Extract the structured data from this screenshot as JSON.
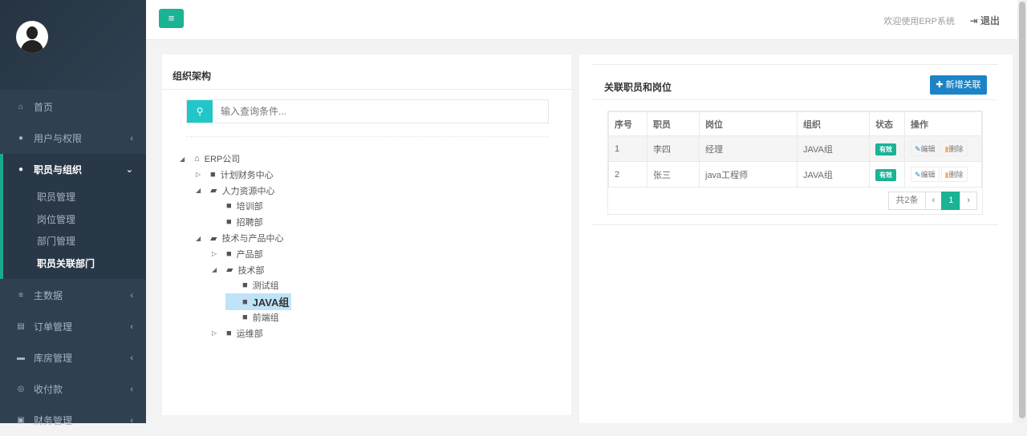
{
  "sidebar": {
    "items": [
      {
        "label": "首页",
        "icon": "home-icon"
      },
      {
        "label": "用户与权限",
        "icon": "info-icon"
      },
      {
        "label": "职员与组织",
        "icon": "user-circle-icon"
      },
      {
        "label": "主数据",
        "icon": "database-icon"
      },
      {
        "label": "订单管理",
        "icon": "list-alt-icon"
      },
      {
        "label": "库房管理",
        "icon": "truck-icon"
      },
      {
        "label": "收付款",
        "icon": "handshake-icon"
      },
      {
        "label": "财务管理",
        "icon": "calculator-icon"
      }
    ],
    "sub_items": [
      "职员管理",
      "岗位管理",
      "部门管理",
      "职员关联部门"
    ]
  },
  "header": {
    "welcome": "欢迎使用ERP系统",
    "logout": "退出"
  },
  "org": {
    "title": "组织架构",
    "search_placeholder": "输入查询条件...",
    "tree": [
      "ERP公司",
      "计划财务中心",
      "人力资源中心",
      "培训部",
      "招聘部",
      "技术与产品中心",
      "产品部",
      "技术部",
      "测试组",
      "JAVA组",
      "前端组",
      "运维部"
    ]
  },
  "assoc": {
    "title": "关联职员和岗位",
    "add_label": "新增关联",
    "columns": [
      "序号",
      "职员",
      "岗位",
      "组织",
      "状态",
      "操作"
    ],
    "rows": [
      {
        "no": "1",
        "staff": "李四",
        "post": "经理",
        "org": "JAVA组",
        "status": "有效"
      },
      {
        "no": "2",
        "staff": "张三",
        "post": "java工程师",
        "org": "JAVA组",
        "status": "有效"
      }
    ],
    "edit": "编辑",
    "delete": "删除",
    "total": "共2条",
    "page": "1",
    "prev": "‹",
    "next": "›"
  },
  "colors": {
    "accent": "#1ab394",
    "sidebar": "#2f4050",
    "primary": "#1c84c6"
  }
}
